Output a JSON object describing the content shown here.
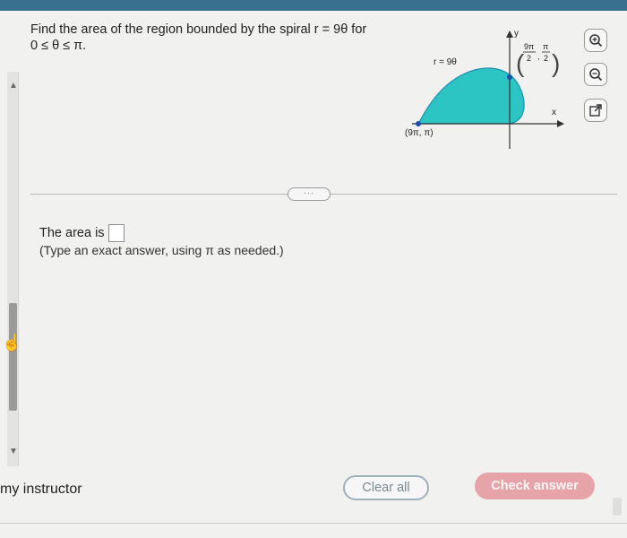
{
  "question": {
    "text_line1": "Find the area of the region bounded by the spiral r = 9θ for",
    "text_line2": "0 ≤ θ ≤ π."
  },
  "graph": {
    "curve_label": "r = 9θ",
    "y_axis_label": "y",
    "x_axis_label": "x",
    "point_top": {
      "num1": "9π",
      "den1": "2",
      "num2": "π",
      "den2": "2"
    },
    "point_left": "(9π, π)",
    "fill_color": "#2cc5c4"
  },
  "divider": {
    "pill_label": "···"
  },
  "answer": {
    "prompt": "The area is",
    "hint": "(Type an exact answer, using π as needed.)"
  },
  "tools": [
    "zoom-in-icon",
    "zoom-out-icon",
    "popout-icon"
  ],
  "footer": {
    "instructor": "my instructor",
    "clear_label": "Clear all",
    "check_label": "Check answer"
  },
  "colors": {
    "top_bar": "#3b6f8f",
    "check_button": "#e6a3a8",
    "clear_border": "#9fb2bb"
  }
}
